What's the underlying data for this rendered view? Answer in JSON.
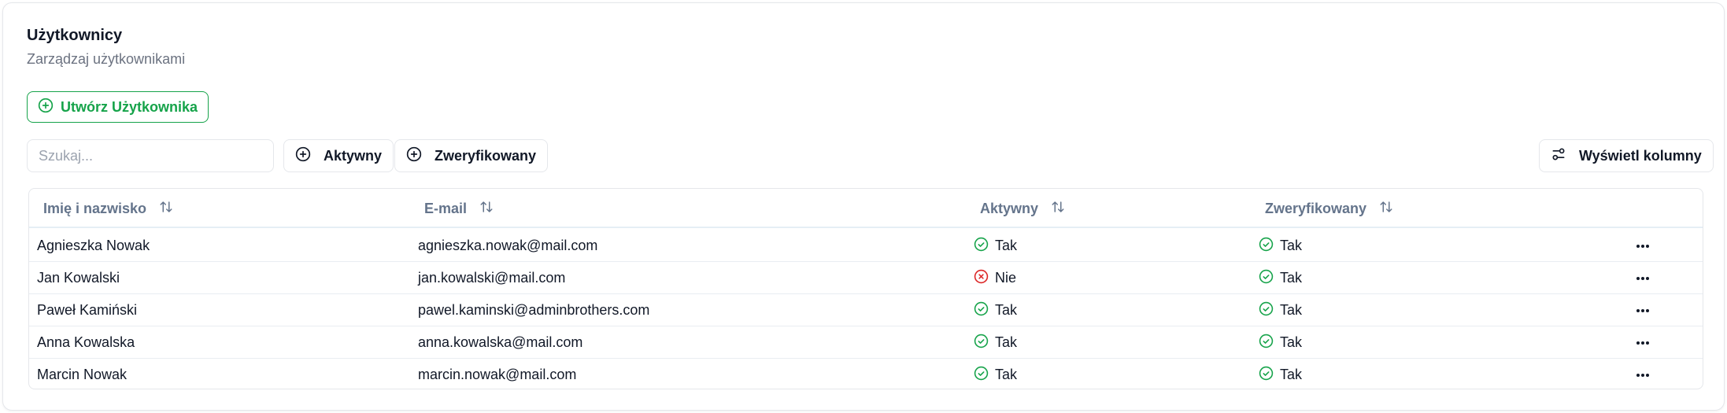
{
  "page": {
    "title": "Użytkownicy",
    "subtitle": "Zarządzaj użytkownikami"
  },
  "toolbar": {
    "create_label": "Utwórz Użytkownika",
    "search_placeholder": "Szukaj...",
    "search_value": "",
    "filter_active_label": "Aktywny",
    "filter_verified_label": "Zweryfikowany",
    "view_columns_label": "Wyświetl kolumny"
  },
  "table": {
    "columns": [
      "Imię i nazwisko",
      "E-mail",
      "Aktywny",
      "Zweryfikowany"
    ],
    "rows": [
      {
        "name": "Agnieszka Nowak",
        "email": "agnieszka.nowak@mail.com",
        "active": "Tak",
        "verified": "Tak"
      },
      {
        "name": "Jan Kowalski",
        "email": "jan.kowalski@mail.com",
        "active": "Nie",
        "verified": "Tak"
      },
      {
        "name": "Paweł Kamiński",
        "email": "pawel.kaminski@adminbrothers.com",
        "active": "Tak",
        "verified": "Tak"
      },
      {
        "name": "Anna Kowalska",
        "email": "anna.kowalska@mail.com",
        "active": "Tak",
        "verified": "Tak"
      },
      {
        "name": "Marcin Nowak",
        "email": "marcin.nowak@mail.com",
        "active": "Tak",
        "verified": "Tak"
      }
    ]
  },
  "colors": {
    "accent": "#16a34a",
    "negative": "#dc2626",
    "muted": "#6b7280"
  },
  "icons": {
    "create": "plus-circle-icon",
    "filter": "plus-circle-icon",
    "columns": "sliders-icon",
    "sort": "sort-arrows-icon",
    "yes": "check-circle-icon",
    "no": "x-circle-icon",
    "row_actions": "more-horizontal-icon"
  }
}
